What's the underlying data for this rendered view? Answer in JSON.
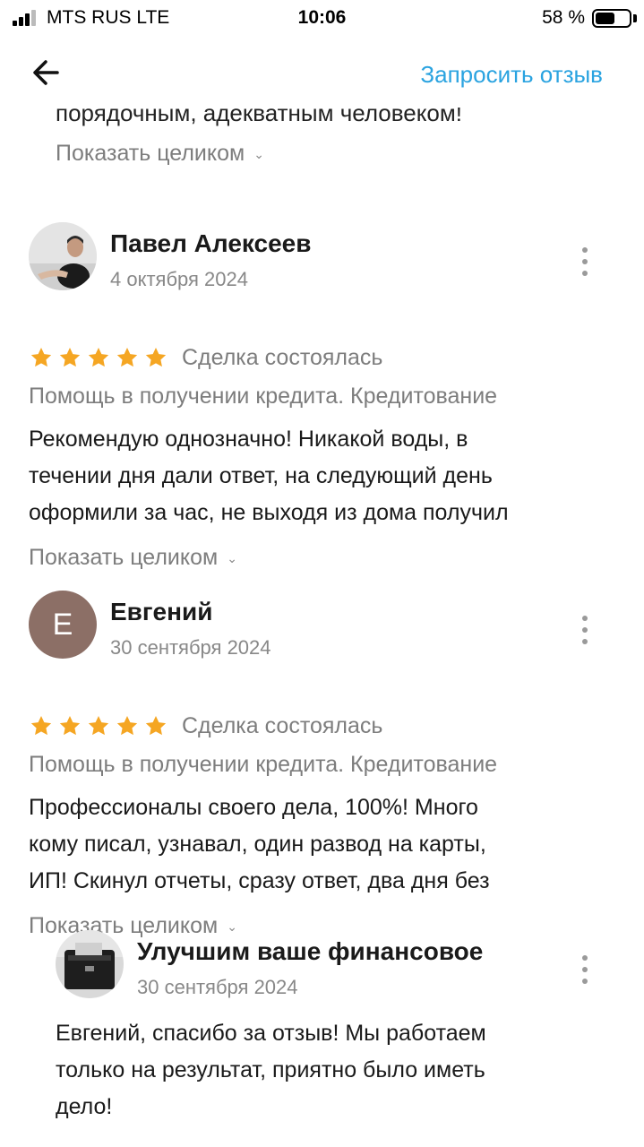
{
  "status_bar": {
    "carrier": "MTS RUS  LTE",
    "time": "10:06",
    "battery_percent": "58 %",
    "battery_level": 0.58
  },
  "header": {
    "request_review_label": "Запросить отзыв"
  },
  "prev_review": {
    "cut_text": "порядочным, адекватным человеком!",
    "show_more": "Показать целиком"
  },
  "reviews": [
    {
      "author": "Павел Алексеев",
      "date": "4 октября 2024",
      "rating": 5,
      "deal_status": "Сделка состоялась",
      "service": "Помощь в получении кредита. Кредитование",
      "lines": [
        "Рекомендую однозначно! Никакой воды, в",
        "течении дня дали ответ, на следующий день",
        "оформили за час, не выходя из дома получил"
      ],
      "show_more": "Показать целиком"
    },
    {
      "author": "Евгений",
      "avatar_letter": "Е",
      "avatar_color": "#8c6f66",
      "date": "30 сентября 2024",
      "rating": 5,
      "deal_status": "Сделка состоялась",
      "service": "Помощь в получении кредита. Кредитование",
      "lines": [
        "Профессионалы своего дела, 100%! Много",
        "кому писал, узнавал, один развод на карты,",
        "ИП! Скинул отчеты, сразу ответ, два дня без"
      ],
      "show_more": "Показать целиком"
    }
  ],
  "reply": {
    "author": "Улучшим ваше финансовое",
    "date": "30 сентября 2024",
    "lines": [
      "Евгений, спасибо за отзыв! Мы работаем",
      "только на результат, приятно было иметь",
      "дело!"
    ]
  },
  "colors": {
    "accent": "#2aa3e0",
    "star": "#f5a623",
    "muted": "#7d7d7d"
  },
  "icons": [
    "back-arrow-icon",
    "star-icon",
    "more-vertical-icon",
    "chevron-down-icon"
  ]
}
